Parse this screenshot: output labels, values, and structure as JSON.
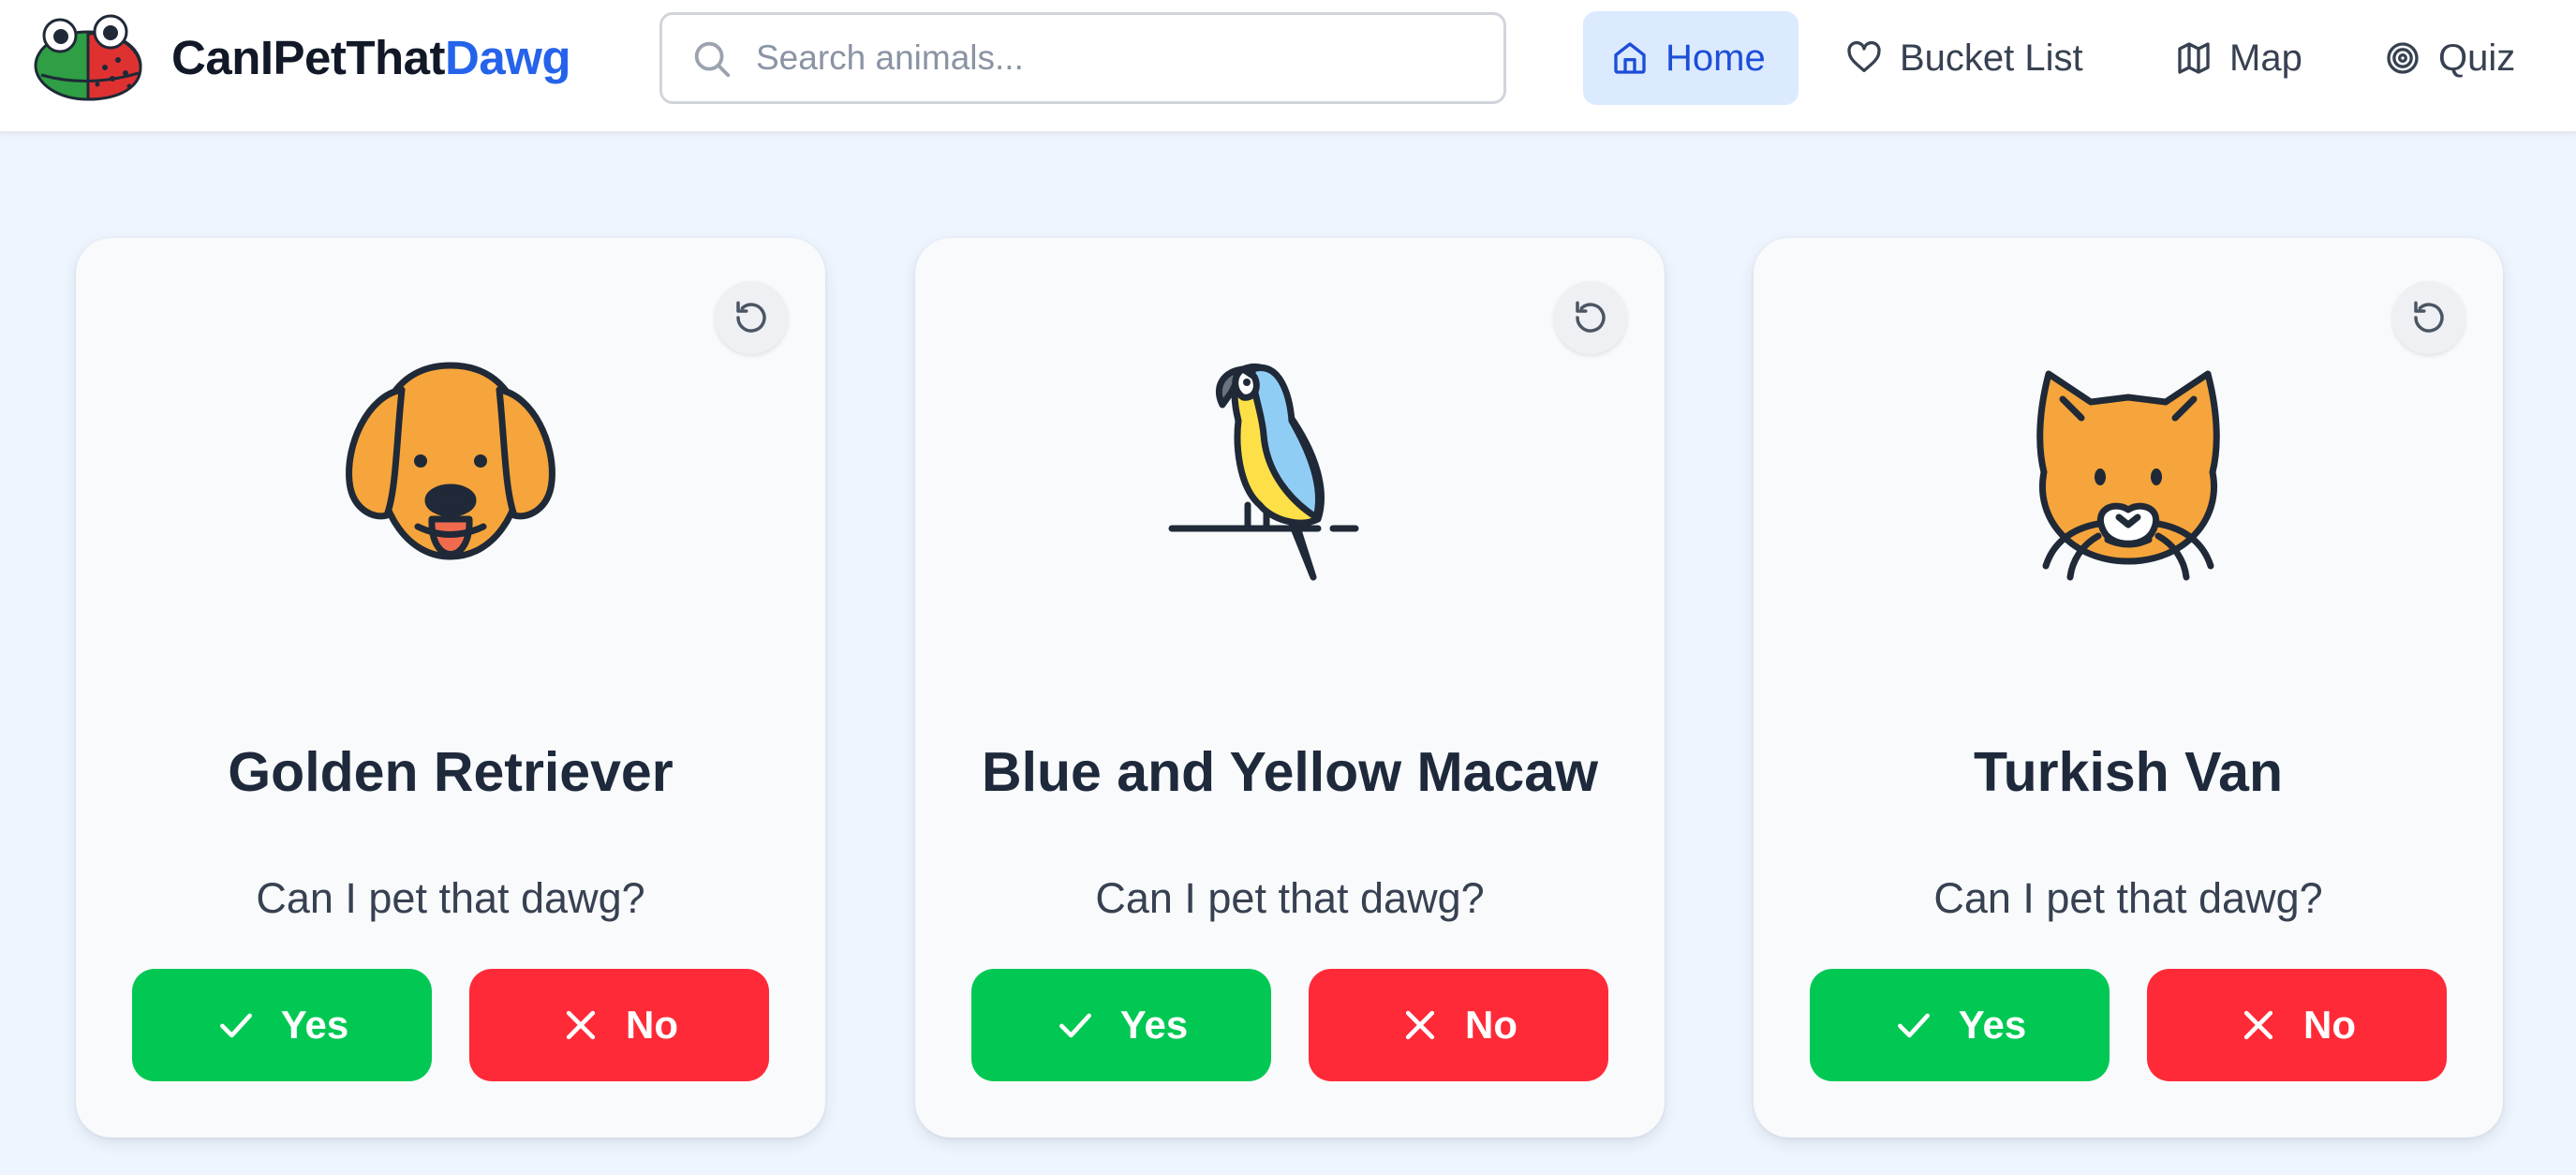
{
  "brand": {
    "part1": "CanIPetThat",
    "part2": "Dawg",
    "logo_icon": "frog-logo-icon"
  },
  "search": {
    "placeholder": "Search animals...",
    "value": ""
  },
  "nav": [
    {
      "label": "Home",
      "icon": "home-icon",
      "active": true
    },
    {
      "label": "Bucket List",
      "icon": "heart-icon",
      "active": false
    },
    {
      "label": "Map",
      "icon": "map-icon",
      "active": false
    },
    {
      "label": "Quiz",
      "icon": "target-icon",
      "active": false
    }
  ],
  "cards": [
    {
      "name": "Golden Retriever",
      "icon": "dog-icon",
      "question": "Can I pet that dawg?",
      "yes_label": "Yes",
      "no_label": "No"
    },
    {
      "name": "Blue and Yellow Macaw",
      "icon": "parrot-icon",
      "question": "Can I pet that dawg?",
      "yes_label": "Yes",
      "no_label": "No"
    },
    {
      "name": "Turkish Van",
      "icon": "cat-icon",
      "question": "Can I pet that dawg?",
      "yes_label": "Yes",
      "no_label": "No"
    }
  ],
  "colors": {
    "accent": "#2563eb",
    "nav_active_bg": "#dbeafe",
    "yes": "#00c853",
    "no": "#ff2a38",
    "background": "#eef5fe"
  }
}
